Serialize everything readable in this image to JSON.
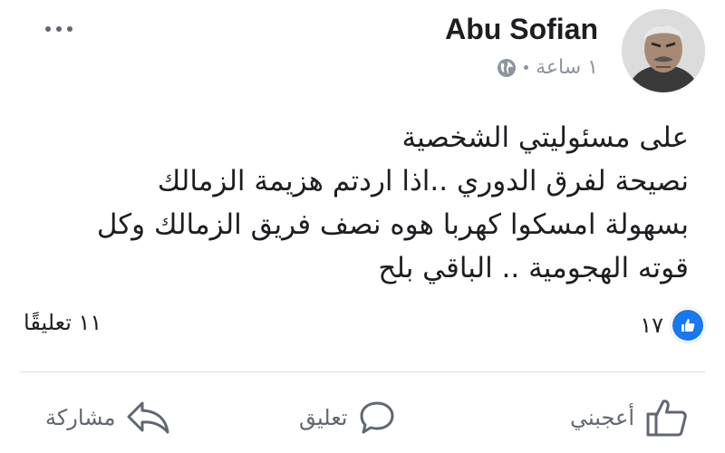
{
  "post": {
    "author": "Abu Sofian",
    "timestamp": "١ ساعة",
    "privacy_icon": "globe-icon",
    "text_lines": [
      "على مسئوليتي الشخصية",
      "نصيحة لفرق الدوري ..اذا اردتم هزيمة الزمالك",
      "بسهولة  امسكوا كهربا هوه نصف فريق الزمالك وكل",
      "قوته الهجومية .. الباقي بلح"
    ]
  },
  "stats": {
    "reaction_icon": "like-icon",
    "reaction_count": "١٧",
    "comments": "١١ تعليقًا"
  },
  "actions": {
    "like": "أعجبني",
    "comment": "تعليق",
    "share": "مشاركة"
  },
  "colors": {
    "brand_blue": "#1877f2",
    "muted": "#606770",
    "meta": "#8d949e"
  }
}
